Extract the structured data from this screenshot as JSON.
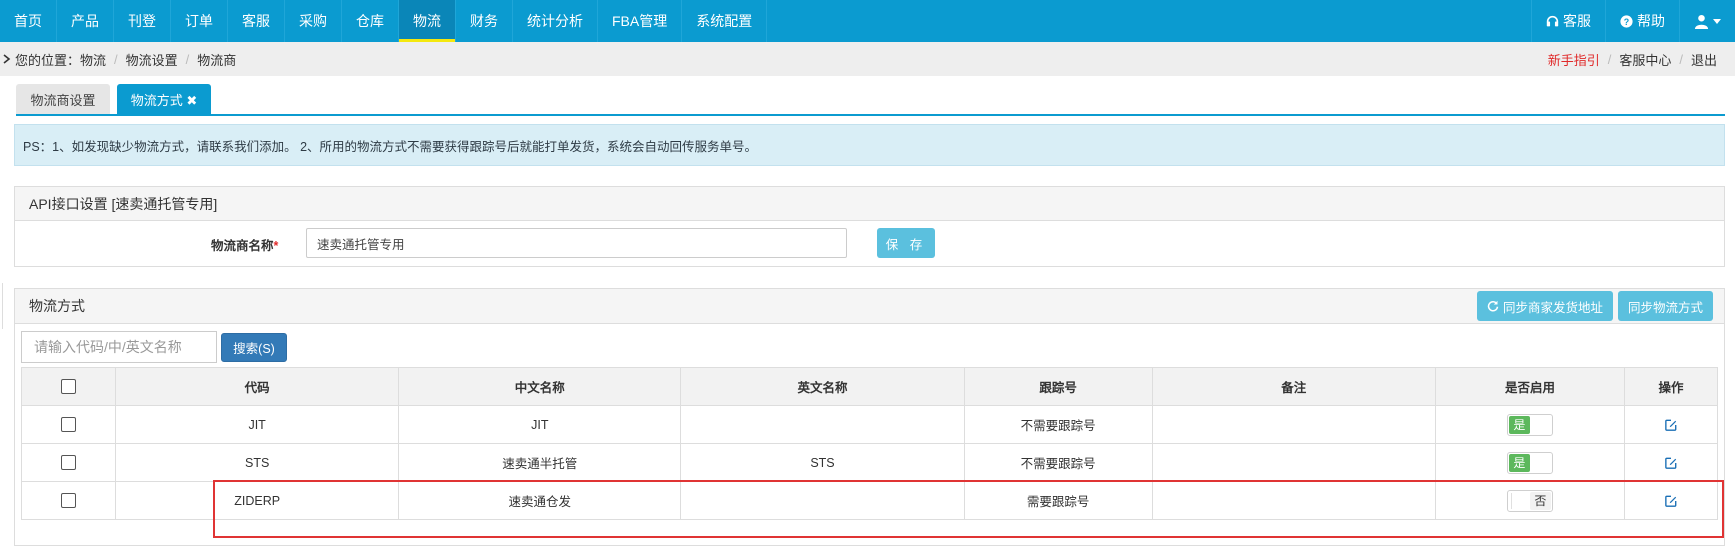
{
  "nav": {
    "items": [
      {
        "label": "首页"
      },
      {
        "label": "产品"
      },
      {
        "label": "刊登"
      },
      {
        "label": "订单"
      },
      {
        "label": "客服"
      },
      {
        "label": "采购"
      },
      {
        "label": "仓库"
      },
      {
        "label": "物流",
        "active": true
      },
      {
        "label": "财务"
      },
      {
        "label": "统计分析"
      },
      {
        "label": "FBA管理"
      },
      {
        "label": "系统配置"
      }
    ],
    "service_label": "客服",
    "help_label": "帮助",
    "user_icon": "user-icon"
  },
  "breadcrumb": {
    "prefix": "您的位置：",
    "items": [
      "物流",
      "物流设置",
      "物流商"
    ],
    "right": {
      "guide": "新手指引",
      "service_center": "客服中心",
      "logout": "退出"
    }
  },
  "tabs": [
    {
      "label": "物流商设置"
    },
    {
      "label": "物流方式 ✖",
      "active": true
    }
  ],
  "notice": "PS：1、如发现缺少物流方式，请联系我们添加。 2、所用的物流方式不需要获得跟踪号后就能打单发货，系统会自动回传服务单号。",
  "api_panel": {
    "title": "API接口设置  [速卖通托管专用]",
    "field_label": "物流商名称",
    "required_mark": "*",
    "field_value": "速卖通托管专用",
    "save_label": "保 存"
  },
  "method_panel": {
    "title": "物流方式",
    "sync_address_label": "同步商家发货地址",
    "sync_method_label": "同步物流方式",
    "search_placeholder": "请输入代码/中/英文名称",
    "search_button": "搜索(S)",
    "columns": [
      "代码",
      "中文名称",
      "英文名称",
      "跟踪号",
      "备注",
      "是否启用",
      "操作"
    ],
    "rows": [
      {
        "code": "JIT",
        "cn_name": "JIT",
        "en_name": "",
        "tracking": "不需要跟踪号",
        "remark": "",
        "enabled": true,
        "enabled_label": "是"
      },
      {
        "code": "STS",
        "cn_name": "速卖通半托管",
        "en_name": "STS",
        "tracking": "不需要跟踪号",
        "remark": "",
        "enabled": true,
        "enabled_label": "是"
      },
      {
        "code": "ZIDERP",
        "cn_name": "速卖通仓发",
        "en_name": "",
        "tracking": "需要跟踪号",
        "remark": "",
        "enabled": false,
        "enabled_label": "否"
      }
    ]
  },
  "colors": {
    "nav_bg": "#0b9bd0",
    "active_underline": "#f4e80e",
    "info_button": "#5bc0de",
    "primary_button": "#337ab7",
    "toggle_on": "#5cb85c",
    "highlight": "#e03434"
  }
}
